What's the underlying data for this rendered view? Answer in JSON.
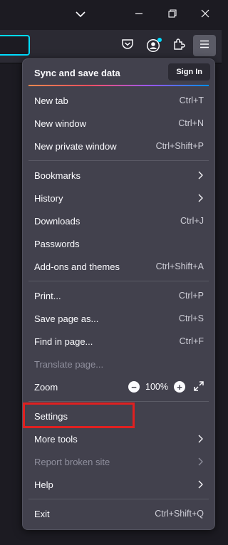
{
  "menu": {
    "sync": {
      "title": "Sync and save data",
      "signin_label": "Sign In"
    },
    "group1": [
      {
        "label": "New tab",
        "shortcut": "Ctrl+T"
      },
      {
        "label": "New window",
        "shortcut": "Ctrl+N"
      },
      {
        "label": "New private window",
        "shortcut": "Ctrl+Shift+P"
      }
    ],
    "group2": [
      {
        "label": "Bookmarks",
        "submenu": true
      },
      {
        "label": "History",
        "submenu": true
      },
      {
        "label": "Downloads",
        "shortcut": "Ctrl+J"
      },
      {
        "label": "Passwords"
      },
      {
        "label": "Add-ons and themes",
        "shortcut": "Ctrl+Shift+A"
      }
    ],
    "group3": [
      {
        "label": "Print...",
        "shortcut": "Ctrl+P"
      },
      {
        "label": "Save page as...",
        "shortcut": "Ctrl+S"
      },
      {
        "label": "Find in page...",
        "shortcut": "Ctrl+F"
      },
      {
        "label": "Translate page...",
        "disabled": true
      }
    ],
    "zoom": {
      "label": "Zoom",
      "value": "100%",
      "minus": "−",
      "plus": "+"
    },
    "group4": [
      {
        "label": "Settings"
      },
      {
        "label": "More tools",
        "submenu": true
      },
      {
        "label": "Report broken site",
        "submenu": true,
        "disabled": true
      },
      {
        "label": "Help",
        "submenu": true
      }
    ],
    "exit": {
      "label": "Exit",
      "shortcut": "Ctrl+Shift+Q"
    }
  },
  "colors": {
    "panel_bg": "#42414d",
    "accent_focus": "#00ddff",
    "highlight_box": "#e02020",
    "notification_dot": "#00ddff"
  },
  "icons": {
    "titlebar": [
      "chevron-down-icon",
      "minimize-icon",
      "restore-icon",
      "close-icon"
    ],
    "toolbar": [
      "pocket-icon",
      "account-icon",
      "extensions-icon",
      "hamburger-menu-icon"
    ]
  }
}
